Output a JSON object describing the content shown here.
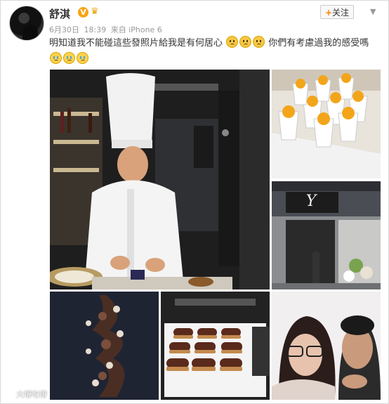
{
  "post": {
    "username": "舒淇",
    "verified_badge": "V",
    "date": "6月30日",
    "time": "18:39",
    "source": "来自 iPhone 6",
    "follow_label": "关注",
    "follow_plus": "+",
    "text": "明知道我不能碰這些發照片給我是有何居心",
    "text_after": "你們有考慮過我的感受嗎",
    "icons": {
      "avatar": "avatar-photo",
      "verified": "verified-v-icon",
      "member": "crown-icon",
      "menu": "chevron-down-icon",
      "emoji_sad": "sad-face-emoji",
      "emoji_cry": "crying-face-emoji"
    }
  },
  "photos": [
    {
      "name": "chef-cooking-photo"
    },
    {
      "name": "dessert-cups-photo"
    },
    {
      "name": "storefront-photo"
    },
    {
      "name": "chocolate-sculpture-photo"
    },
    {
      "name": "eclairs-tray-photo"
    },
    {
      "name": "selfie-photo"
    }
  ],
  "storefront_sign": "Y",
  "watermark": "大嘢吃嘢",
  "colors": {
    "accent": "#ff8200",
    "verified": "#f7a413",
    "meta_text": "#999999"
  }
}
